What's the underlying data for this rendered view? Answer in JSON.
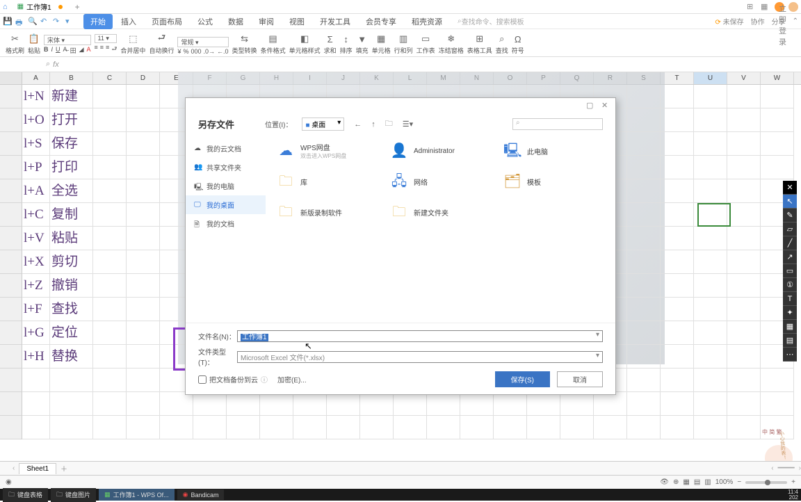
{
  "title_bar": {
    "doc_name": "工作簿1",
    "add_tooltip": "+",
    "login_btn": "立即登录"
  },
  "menu": {
    "tabs": [
      "开始",
      "插入",
      "页面布局",
      "公式",
      "数据",
      "审阅",
      "视图",
      "开发工具",
      "会员专享",
      "稻壳资源"
    ],
    "active_index": 0,
    "search_placeholder": "查找命令、搜索模板",
    "right": {
      "unsaved": "未保存",
      "coop": "协作",
      "share": "分享"
    }
  },
  "ribbon": {
    "groups": [
      "格式刷",
      "粘贴",
      "B",
      "I",
      "U",
      "田",
      "类型转换",
      "条件格式",
      "单元格样式",
      "求和",
      "排序",
      "填充",
      "单元格",
      "行和列",
      "工作表",
      "冻结窗格",
      "表格工具",
      "查找",
      "符号"
    ]
  },
  "formula": {
    "cell_ref": "",
    "fx": "fx"
  },
  "columns": [
    "A",
    "B",
    "C",
    "D",
    "E",
    "F",
    "G",
    "H",
    "I",
    "J",
    "K",
    "L",
    "M",
    "N",
    "O",
    "P",
    "Q",
    "R",
    "S",
    "T",
    "U",
    "V",
    "W"
  ],
  "selected_col": "U",
  "rows": [
    {
      "a": "l+N",
      "b": "新建"
    },
    {
      "a": "l+O",
      "b": "打开"
    },
    {
      "a": "l+S",
      "b": "保存"
    },
    {
      "a": "l+P",
      "b": "打印"
    },
    {
      "a": "l+A",
      "b": "全选"
    },
    {
      "a": "l+C",
      "b": "复制"
    },
    {
      "a": "l+V",
      "b": "粘贴"
    },
    {
      "a": "l+X",
      "b": "剪切"
    },
    {
      "a": "l+Z",
      "b": "撤销"
    },
    {
      "a": "l+F",
      "b": "查找"
    },
    {
      "a": "l+G",
      "b": "定位"
    },
    {
      "a": "l+H",
      "b": "替换"
    }
  ],
  "dialog": {
    "title": "另存文件",
    "location_label": "位置(I)：",
    "location_value": "桌面",
    "side_items": [
      {
        "icon": "cloud",
        "label": "我的云文档"
      },
      {
        "icon": "share",
        "label": "共享文件夹"
      },
      {
        "icon": "pc",
        "label": "我的电脑"
      },
      {
        "icon": "desktop",
        "label": "我的桌面",
        "active": true
      },
      {
        "icon": "docs",
        "label": "我的文档"
      }
    ],
    "folders": [
      {
        "icon": "cloud-big",
        "label": "WPS网盘",
        "sub": "双击进入WPS网盘"
      },
      {
        "icon": "person",
        "label": "Administrator"
      },
      {
        "icon": "thispc",
        "label": "此电脑"
      },
      {
        "icon": "libfold",
        "label": "库"
      },
      {
        "icon": "network",
        "label": "网络"
      },
      {
        "icon": "tmpl",
        "label": "模板"
      },
      {
        "icon": "folder",
        "label": "新版录制软件"
      },
      {
        "icon": "folder",
        "label": "新建文件夹"
      }
    ],
    "filename_label": "文件名(N)：",
    "filename_value": "工作簿1",
    "filetype_label": "文件类型(T)：",
    "filetype_value": "Microsoft Excel 文件(*.xlsx)",
    "backup_checkbox": "把文档备份到云",
    "encrypt": "加密(E)...",
    "save_btn": "保存(S)",
    "cancel_btn": "取消"
  },
  "sheets": {
    "name": "Sheet1"
  },
  "status": {
    "zoom": "100%"
  },
  "taskbar": {
    "items": [
      "键盘表格",
      "键盘图片",
      "工作簿1 - WPS Of...",
      "Bandicam"
    ],
    "active_index": 2,
    "time1": "11:4",
    "time2": "202"
  },
  "mascot": {
    "hints": "中 简 繁",
    "side": "小心我的表！"
  }
}
